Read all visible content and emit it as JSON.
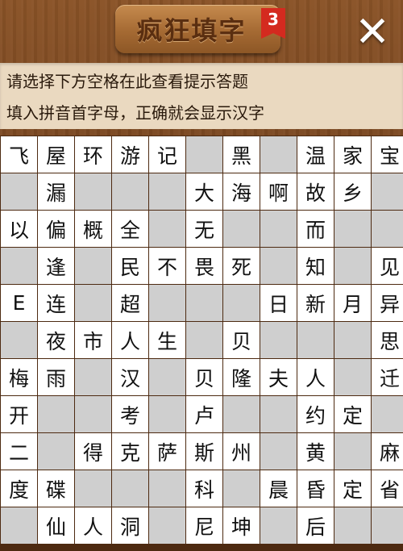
{
  "header": {
    "title": "疯狂填字",
    "level_badge": "3",
    "close_glyph": "✕"
  },
  "hints": {
    "line1": "请选择下方空格在此查看提示答题",
    "line2": "填入拼音首字母，正确就会显示汉字"
  },
  "colors": {
    "wood": "#7a4621",
    "hint_bg": "#ead9c0",
    "cell_filled": "#ffffff",
    "cell_blank": "#cfcfcf",
    "badge": "#d42a1f"
  },
  "grid": {
    "rows": [
      [
        "飞",
        "屋",
        "环",
        "游",
        "记",
        "",
        "黑",
        "",
        "温",
        "家",
        "宝"
      ],
      [
        "",
        "漏",
        "",
        "",
        "",
        "大",
        "海",
        "啊",
        "故",
        "乡",
        ""
      ],
      [
        "以",
        "偏",
        "概",
        "全",
        "",
        "无",
        "",
        "",
        "而",
        "",
        ""
      ],
      [
        "",
        "逢",
        "",
        "民",
        "不",
        "畏",
        "死",
        "",
        "知",
        "",
        "见"
      ],
      [
        "E",
        "连",
        "",
        "超",
        "",
        "",
        "",
        "日",
        "新",
        "月",
        "异"
      ],
      [
        "",
        "夜",
        "市",
        "人",
        "生",
        "",
        "贝",
        "",
        "",
        "",
        "思"
      ],
      [
        "梅",
        "雨",
        "",
        "汉",
        "",
        "贝",
        "隆",
        "夫",
        "人",
        "",
        "迁"
      ],
      [
        "开",
        "",
        "",
        "考",
        "",
        "卢",
        "",
        "",
        "约",
        "定",
        ""
      ],
      [
        "二",
        "",
        "得",
        "克",
        "萨",
        "斯",
        "州",
        "",
        "黄",
        "",
        "麻"
      ],
      [
        "度",
        "碟",
        "",
        "",
        "",
        "科",
        "",
        "晨",
        "昏",
        "定",
        "省"
      ],
      [
        "",
        "仙",
        "人",
        "洞",
        "",
        "尼",
        "坤",
        "",
        "后",
        "",
        ""
      ]
    ],
    "white_mask": [
      [
        1,
        1,
        1,
        1,
        1,
        0,
        1,
        0,
        1,
        1,
        1
      ],
      [
        0,
        1,
        0,
        0,
        0,
        1,
        1,
        1,
        1,
        1,
        0
      ],
      [
        1,
        1,
        1,
        1,
        0,
        1,
        0,
        0,
        1,
        0,
        0
      ],
      [
        0,
        1,
        0,
        1,
        1,
        1,
        1,
        0,
        1,
        0,
        1
      ],
      [
        1,
        1,
        0,
        1,
        0,
        0,
        0,
        1,
        1,
        1,
        1
      ],
      [
        0,
        1,
        1,
        1,
        1,
        0,
        1,
        0,
        0,
        0,
        1
      ],
      [
        1,
        1,
        0,
        1,
        0,
        1,
        1,
        1,
        1,
        0,
        1
      ],
      [
        1,
        0,
        0,
        1,
        0,
        1,
        0,
        0,
        1,
        1,
        0
      ],
      [
        1,
        0,
        1,
        1,
        1,
        1,
        1,
        0,
        1,
        0,
        1
      ],
      [
        1,
        1,
        0,
        0,
        0,
        1,
        0,
        1,
        1,
        1,
        1
      ],
      [
        0,
        1,
        1,
        1,
        0,
        1,
        1,
        0,
        1,
        0,
        0
      ]
    ]
  }
}
